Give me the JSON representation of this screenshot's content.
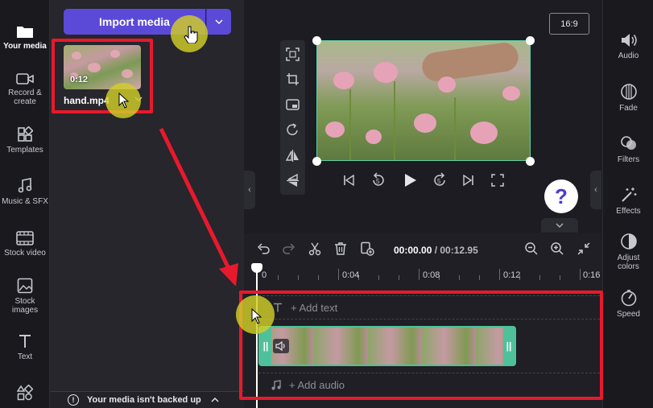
{
  "left_rail": {
    "items": [
      {
        "label": "Your media",
        "icon": "folder-icon"
      },
      {
        "label": "Record &\ncreate",
        "icon": "camera-icon"
      },
      {
        "label": "Templates",
        "icon": "templates-icon"
      },
      {
        "label": "Music & SFX",
        "icon": "music-icon"
      },
      {
        "label": "Stock video",
        "icon": "film-icon"
      },
      {
        "label": "Stock\nimages",
        "icon": "image-icon"
      },
      {
        "label": "Text",
        "icon": "text-icon"
      },
      {
        "label": "",
        "icon": "shapes-icon"
      }
    ]
  },
  "media_panel": {
    "import_label": "Import media",
    "tile": {
      "duration": "0:12",
      "name": "hand.mp4"
    },
    "backup_notice": "Your media isn't backed up"
  },
  "preview": {
    "aspect_ratio": "16:9",
    "help_label": "?"
  },
  "right_rail": {
    "items": [
      {
        "label": "Audio",
        "icon": "speaker-icon"
      },
      {
        "label": "Fade",
        "icon": "fade-icon"
      },
      {
        "label": "Filters",
        "icon": "filters-icon"
      },
      {
        "label": "Effects",
        "icon": "effects-icon"
      },
      {
        "label": "Adjust\ncolors",
        "icon": "contrast-icon"
      },
      {
        "label": "Speed",
        "icon": "speed-icon"
      }
    ]
  },
  "timeline": {
    "current_time": "00:00.00",
    "total_time": "/ 00:12.95",
    "ruler_labels": [
      "0",
      "0:04",
      "0:08",
      "0:12",
      "0:16"
    ],
    "text_track_label": "+ Add text",
    "audio_track_label": "+ Add audio"
  },
  "colors": {
    "accent": "#5b4ad8",
    "clip_border": "#4fc19a",
    "annotation_red": "#e8192c",
    "cursor_halo": "#d2ce28"
  }
}
